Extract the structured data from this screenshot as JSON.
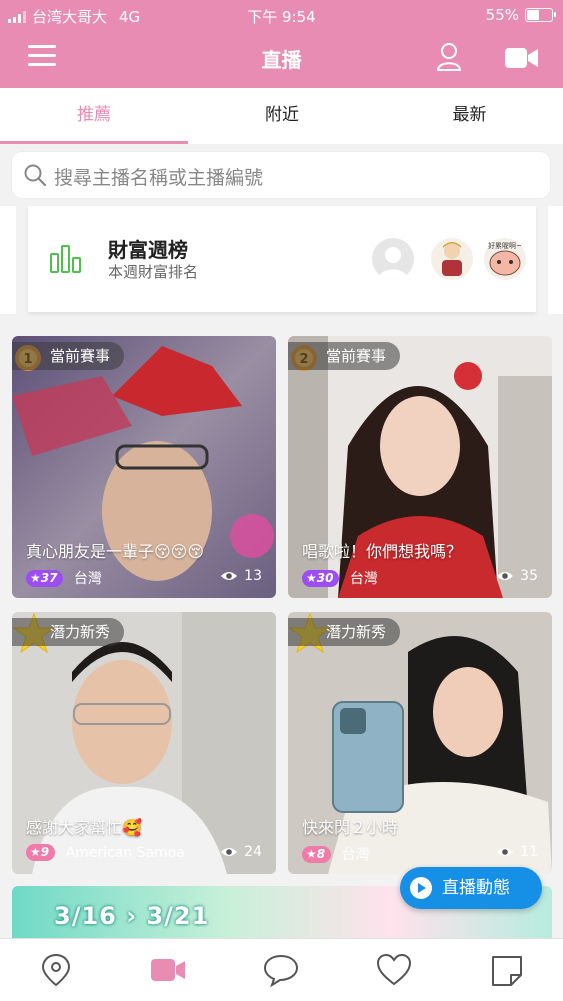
{
  "status_bar": {
    "carrier": "台湾大哥大",
    "network": "4G",
    "time": "下午 9:54",
    "battery": "55%"
  },
  "header": {
    "title": "直播",
    "icons": [
      "menu-icon",
      "user-icon",
      "video-camera-icon"
    ]
  },
  "tabs": [
    {
      "label": "推薦",
      "active": true
    },
    {
      "label": "附近",
      "active": false
    },
    {
      "label": "最新",
      "active": false
    }
  ],
  "search": {
    "placeholder": "搜尋主播名稱或主播編號"
  },
  "wealth_banner": {
    "title": "財富週榜",
    "subtitle": "本週財富排名",
    "avatar_caption": "好累喔啊~"
  },
  "streams": [
    {
      "badge": "當前賽事",
      "medal": "1",
      "caption": "真心朋友是一輩子😚😚😚",
      "level": "37",
      "country": "台灣",
      "viewers": "13",
      "level_color": "#9c4ef0"
    },
    {
      "badge": "當前賽事",
      "medal": "2",
      "caption": "唱歌啦！你們想我嗎？",
      "level": "30",
      "country": "台灣",
      "viewers": "35",
      "level_color": "#9c4ef0"
    },
    {
      "badge": "潛力新秀",
      "medal": "",
      "caption": "感謝大家幫忙🥰",
      "level": "9",
      "country": "American Samoa",
      "viewers": "24",
      "level_color": "#f07aa8"
    },
    {
      "badge": "潛力新秀",
      "medal": "",
      "caption": "快來閃２小時",
      "level": "8",
      "country": "台灣",
      "viewers": "11",
      "level_color": "#f07aa8"
    }
  ],
  "promo": {
    "text": "3/16 › 3/21"
  },
  "live_button": {
    "label": "直播動態"
  },
  "tabbar": {
    "items": [
      "location-icon",
      "video-icon",
      "chat-icon",
      "heart-icon",
      "note-icon"
    ],
    "active": "video-icon"
  },
  "colors": {
    "brand_pink": "#e98cb3",
    "action_blue": "#1690e6"
  }
}
